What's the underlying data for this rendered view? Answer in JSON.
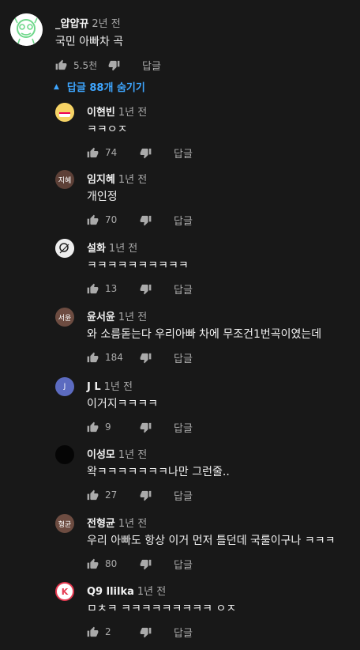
{
  "top_comment": {
    "author": "_얍얍뀨",
    "time": "2년 전",
    "text": "국민 아빠차 곡",
    "likes": "5.5천",
    "reply_label": "답글"
  },
  "replies_toggle": {
    "label": "답글 88개 숨기기"
  },
  "replies": [
    {
      "author": "이현빈",
      "time": "1년 전",
      "text": "ㅋㅋㅇㅈ",
      "likes": "74",
      "reply_label": "답글",
      "avatar_text": "",
      "avatar_color": "#f4d35e"
    },
    {
      "author": "임지혜",
      "time": "1년 전",
      "text": "개인정",
      "likes": "70",
      "reply_label": "답글",
      "avatar_text": "지혜",
      "avatar_color": "#5d4037"
    },
    {
      "author": "설화",
      "time": "1년 전",
      "text": "ㅋㅋㅋㅋㅋㅋㅋㅋㅋㅋ",
      "likes": "13",
      "reply_label": "답글",
      "avatar_text": "",
      "avatar_color": "#e0e0e0"
    },
    {
      "author": "윤서윤",
      "time": "1년 전",
      "text": "와 소름돋는다 우리아빠 차에 무조건1번곡이였는데",
      "likes": "184",
      "reply_label": "답글",
      "avatar_text": "서윤",
      "avatar_color": "#6d4c41"
    },
    {
      "author": "J L",
      "time": "1년 전",
      "text": "이거지ㅋㅋㅋㅋ",
      "likes": "9",
      "reply_label": "답글",
      "avatar_text": "J",
      "avatar_color": "#5c6bc0"
    },
    {
      "author": "이성모",
      "time": "1년 전",
      "text": "왁ㅋㅋㅋㅋㅋㅋㅋ나만 그런줄..",
      "likes": "27",
      "reply_label": "답글",
      "avatar_text": "",
      "avatar_color": "#050505"
    },
    {
      "author": "전형균",
      "time": "1년 전",
      "text": "우리 아빠도 항상 이거 먼저 틀던데 국룰이구나 ㅋㅋㅋ",
      "likes": "80",
      "reply_label": "답글",
      "avatar_text": "형균",
      "avatar_color": "#6d4c41"
    },
    {
      "author": "Q9 llilka",
      "time": "1년 전",
      "text": "ㅁㅊㅋ ㅋㅋㅋㅋㅋㅋㅋㅋㅋ ㅇㅈ",
      "likes": "2",
      "reply_label": "답글",
      "avatar_text": "",
      "avatar_color": "#ffffff"
    }
  ],
  "colors": {
    "background": "#181818",
    "accent": "#3ea6ff",
    "secondary_text": "#aaaaaa"
  }
}
